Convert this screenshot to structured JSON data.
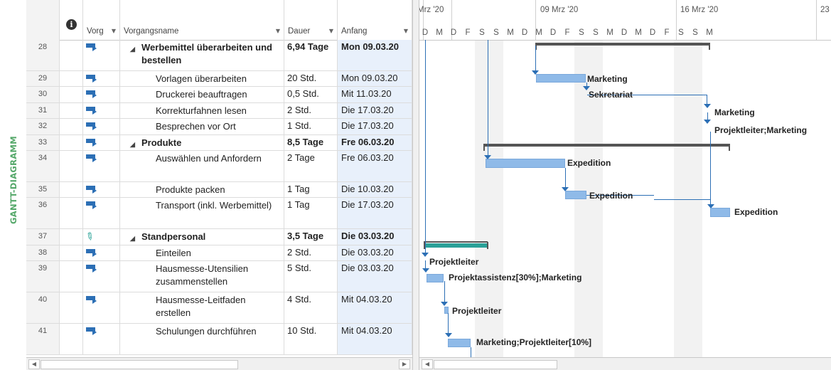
{
  "view_label": "GANTT-DIAGRAMM",
  "columns": {
    "mode": "Vorg",
    "name": "Vorgangsname",
    "duration": "Dauer",
    "start": "Anfang"
  },
  "rows": [
    {
      "id": "28",
      "icon": "auto",
      "name": "Werbemittel überarbeiten und bestellen",
      "summary": true,
      "duration": "6,94 Tage",
      "start": "Mon 09.03.20"
    },
    {
      "id": "29",
      "icon": "auto",
      "name": "Vorlagen überarbeiten",
      "summary": false,
      "duration": "20 Std.",
      "start": "Mon 09.03.20"
    },
    {
      "id": "30",
      "icon": "auto",
      "name": "Druckerei beauftragen",
      "summary": false,
      "duration": "0,5 Std.",
      "start": "Mit 11.03.20"
    },
    {
      "id": "31",
      "icon": "auto",
      "name": "Korrekturfahnen lesen",
      "summary": false,
      "duration": "2 Std.",
      "start": "Die 17.03.20"
    },
    {
      "id": "32",
      "icon": "auto",
      "name": "Besprechen vor Ort",
      "summary": false,
      "duration": "1 Std.",
      "start": "Die 17.03.20"
    },
    {
      "id": "33",
      "icon": "auto",
      "name": "Produkte",
      "summary": true,
      "duration": "8,5 Tage",
      "start": "Fre 06.03.20"
    },
    {
      "id": "34",
      "icon": "auto",
      "name": "Auswählen und Anfordern",
      "summary": false,
      "duration": "2 Tage",
      "start": "Fre 06.03.20"
    },
    {
      "id": "35",
      "icon": "auto",
      "name": "Produkte packen",
      "summary": false,
      "duration": "1 Tag",
      "start": "Die 10.03.20"
    },
    {
      "id": "36",
      "icon": "auto",
      "name": "Transport (inkl. Werbemittel)",
      "summary": false,
      "duration": "1 Tag",
      "start": "Die 17.03.20"
    },
    {
      "id": "37",
      "icon": "manual",
      "name": "Standpersonal",
      "summary": true,
      "duration": "3,5 Tage",
      "start": "Die 03.03.20"
    },
    {
      "id": "38",
      "icon": "auto",
      "name": "Einteilen",
      "summary": false,
      "duration": "2 Std.",
      "start": "Die 03.03.20"
    },
    {
      "id": "39",
      "icon": "auto",
      "name": "Hausmesse-Utensilien zusammenstellen",
      "summary": false,
      "duration": "5 Std.",
      "start": "Die 03.03.20"
    },
    {
      "id": "40",
      "icon": "auto",
      "name": "Hausmesse-Leitfaden erstellen",
      "summary": false,
      "duration": "4 Std.",
      "start": "Mit 04.03.20"
    },
    {
      "id": "41",
      "icon": "auto",
      "name": "Schulungen durchführen",
      "summary": false,
      "duration": "10 Std.",
      "start": "Mit 04.03.20"
    }
  ],
  "timeline": {
    "weeks": [
      "Mrz '20",
      "09 Mrz '20",
      "16 Mrz '20",
      "23"
    ],
    "days": [
      "D",
      "M",
      "D",
      "F",
      "S",
      "S",
      "M",
      "D",
      "M",
      "D",
      "F",
      "S",
      "S",
      "M",
      "D",
      "M",
      "D",
      "F",
      "S",
      "S",
      "M"
    ]
  },
  "gantt_labels": {
    "r29": "Marketing",
    "r30": "Sekretariat",
    "r31": "Marketing",
    "r32": "Projektleiter;Marketing",
    "r34": "Expedition",
    "r35": "Expedition",
    "r36": "Expedition",
    "r38": "Projektleiter",
    "r39": "Projektassistenz[30%];Marketing",
    "r40": "Projektleiter",
    "r41": "Marketing;Projektleiter[10%]"
  }
}
